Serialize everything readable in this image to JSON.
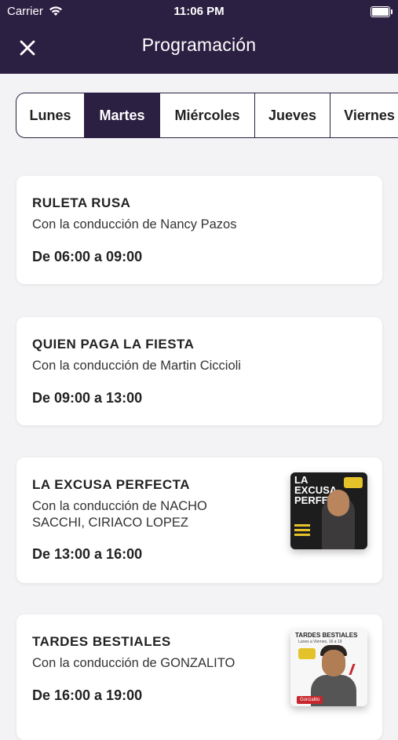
{
  "status_bar": {
    "carrier": "Carrier",
    "time": "11:06 PM"
  },
  "header": {
    "title": "Programación"
  },
  "tabs": [
    {
      "label": "Lunes",
      "active": false
    },
    {
      "label": "Martes",
      "active": true
    },
    {
      "label": "Miércoles",
      "active": false
    },
    {
      "label": "Jueves",
      "active": false
    },
    {
      "label": "Viernes",
      "active": false
    }
  ],
  "programs": [
    {
      "name": "RULETA RUSA",
      "host": "Con la conducción de Nancy Pazos",
      "time": "De 06:00 a 09:00"
    },
    {
      "name": "QUIEN PAGA LA FIESTA",
      "host": "Con la conducción de Martin Ciccioli",
      "time": "De 09:00 a 13:00"
    },
    {
      "name": "LA EXCUSA PERFECTA",
      "host_line1": "Con la conducción de NACHO",
      "host_line2": "SACCHI, CIRIACO LOPEZ",
      "time": "De 13:00 a 16:00",
      "thumb_title": "LA EXCUSA PERFECTA"
    },
    {
      "name": "TARDES BESTIALES",
      "host": "Con la conducción de GONZALITO",
      "time": "De 16:00 a 19:00",
      "thumb_title": "TARDES BESTIALES",
      "thumb_sub": "Lunes a Viernes, 16 a 19",
      "thumb_badge": "Gonzalito"
    }
  ]
}
